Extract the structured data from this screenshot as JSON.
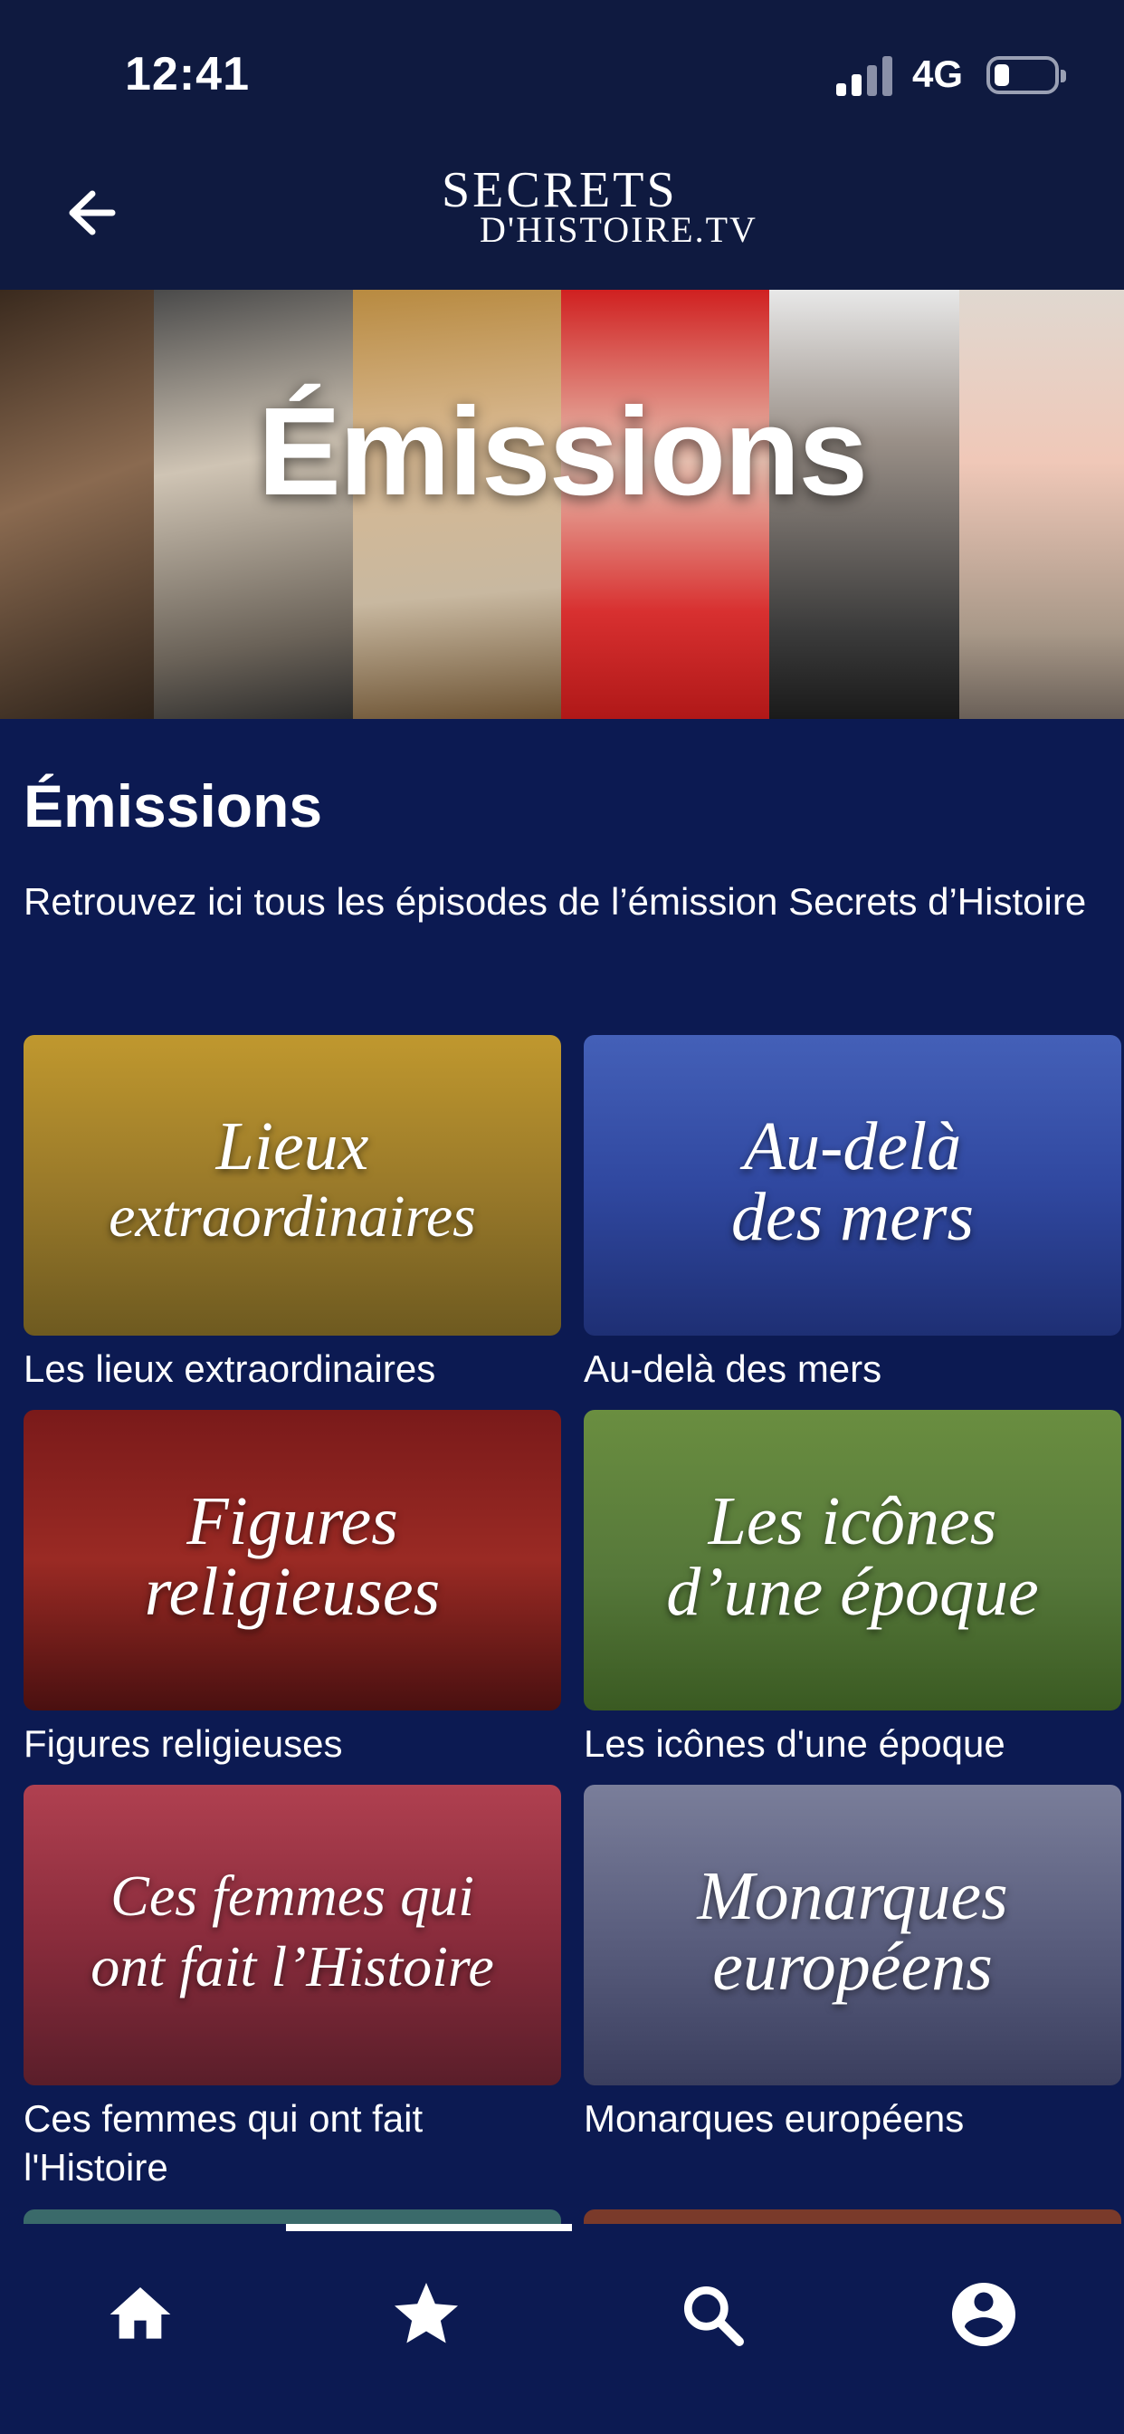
{
  "status_bar": {
    "time": "12:41",
    "network": "4G"
  },
  "header": {
    "logo_line1": "SECRETS",
    "logo_line2": "D'HISTOIRE.TV"
  },
  "hero": {
    "title": "Émissions"
  },
  "page": {
    "title": "Émissions",
    "description": "Retrouvez ici tous les épisodes de l’émission Secrets d’Histoire"
  },
  "cards": [
    {
      "thumb_line1": "Lieux",
      "thumb_line2": "extraordinaires",
      "caption": "Les lieux extraordinaires",
      "color_top": "#b8902a",
      "color_bottom": "#6e5a20"
    },
    {
      "thumb_line1": "Au-delà",
      "thumb_line2": "des mers",
      "caption": "Au-delà des mers",
      "color_top": "#3a56b0",
      "color_bottom": "#1e2f74"
    },
    {
      "thumb_line1": "Figures",
      "thumb_line2": "religieuses",
      "caption": "Figures religieuses",
      "color_top": "#8a2020",
      "color_bottom": "#4a1010"
    },
    {
      "thumb_line1": "Les icônes",
      "thumb_line2": "d’une époque",
      "caption": "Les icônes d'une époque",
      "color_top": "#5a7f38",
      "color_bottom": "#3a5a22"
    },
    {
      "thumb_line1": "Ces femmes qui",
      "thumb_line2": "ont fait l’Histoire",
      "caption": "Ces femmes qui ont fait l'Histoire",
      "color_top": "#a03a4a",
      "color_bottom": "#6a2232"
    },
    {
      "thumb_line1": "Monarques",
      "thumb_line2": "européens",
      "caption": "Monarques européens",
      "color_top": "#6a6e8e",
      "color_bottom": "#3a3e5e"
    }
  ],
  "tabbar": {
    "items": [
      {
        "icon": "home-icon"
      },
      {
        "icon": "star-icon",
        "active": true
      },
      {
        "icon": "search-icon"
      },
      {
        "icon": "profile-icon"
      }
    ]
  },
  "colors": {
    "background": "#0c1a52",
    "header": "#0f1a40",
    "text": "#ffffff"
  }
}
